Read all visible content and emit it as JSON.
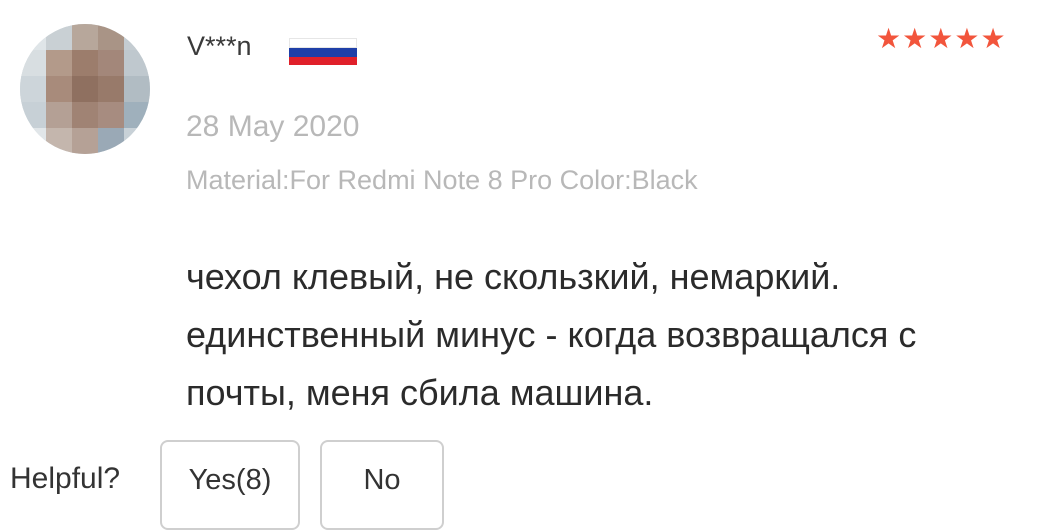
{
  "review": {
    "username": "V***n",
    "country_flag_colors": [
      "#ffffff",
      "#1f3fa8",
      "#e0202a"
    ],
    "rating_stars": 5,
    "star_color": "#f2553c",
    "star_glyph": "★",
    "date": "28 May 2020",
    "sku": "Material:For Redmi Note 8 Pro Color:Black",
    "text": "чехол клевый, не скользкий, немаркий. единственный минус - когда возвращался с почты, меня сбила машина."
  },
  "helpful": {
    "label": "Helpful?",
    "yes_label": "Yes(8)",
    "no_label": "No"
  }
}
